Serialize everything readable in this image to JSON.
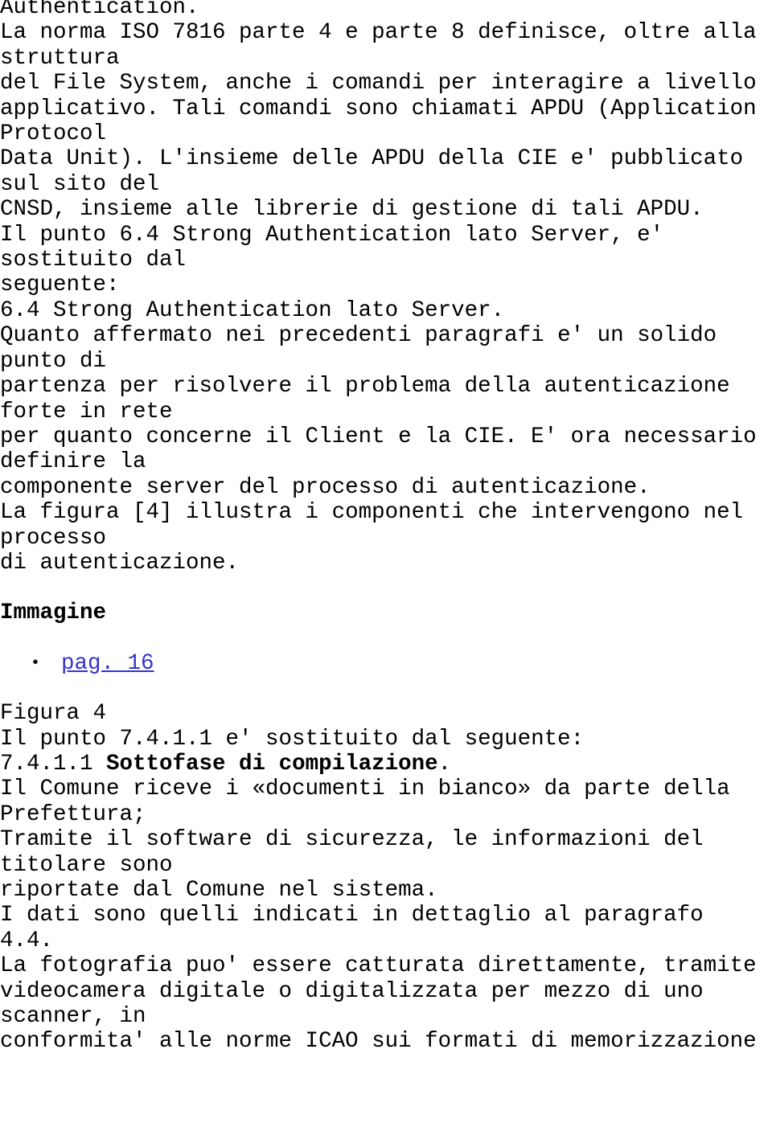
{
  "document": {
    "language": "it",
    "text_color": "#000000",
    "background_color": "#ffffff",
    "link_color": "#3333cc",
    "blocks": [
      {
        "id": "para-1",
        "type": "paragraph",
        "text": "Authentication.\nLa norma ISO 7816 parte 4 e parte 8 definisce, oltre alla\nstruttura\ndel File System, anche i comandi per interagire a livello\napplicativo. Tali comandi sono chiamati APDU (Application\nProtocol\nData Unit). L'insieme delle APDU della CIE e' pubblicato\nsul sito del\nCNSD, insieme alle librerie di gestione di tali APDU.\nIl punto 6.4 Strong Authentication lato Server, e'\nsostituito dal\nseguente:\n6.4 Strong Authentication lato Server.\nQuanto affermato nei precedenti paragrafi e' un solido\npunto di\npartenza per risolvere il problema della autenticazione\nforte in rete\nper quanto concerne il Client e la CIE. E' ora necessario\ndefinire la\ncomponente server del processo di autenticazione.\nLa figura [4] illustra i componenti che intervengono nel\nprocesso\ndi autenticazione."
      },
      {
        "id": "heading-immagine",
        "type": "heading",
        "text": "Immagine"
      },
      {
        "id": "list-pages",
        "type": "list",
        "bullet": "•",
        "items": [
          {
            "label": "pag. 16",
            "is_link": true
          }
        ]
      },
      {
        "id": "para-figura",
        "type": "paragraph",
        "text": "Figura 4"
      },
      {
        "id": "para-punto",
        "type": "paragraph",
        "text": "Il punto 7.4.1.1 e' sostituito dal seguente:"
      },
      {
        "id": "heading-sottofase",
        "type": "mixed-heading",
        "prefix": "7.4.1.1 ",
        "bold": "Sottofase di compilazione",
        "suffix": "."
      },
      {
        "id": "para-final",
        "type": "paragraph",
        "text": "Il Comune riceve i «documenti in bianco» da parte della\nPrefettura;\nTramite il software di sicurezza, le informazioni del\ntitolare sono\nriportate dal Comune nel sistema.\nI dati sono quelli indicati in dettaglio al paragrafo\n4.4.\nLa fotografia puo' essere catturata direttamente, tramite\nvideocamera digitale o digitalizzata per mezzo di uno\nscanner, in\nconformita' alle norme ICAO sui formati di memorizzazione"
      }
    ]
  }
}
